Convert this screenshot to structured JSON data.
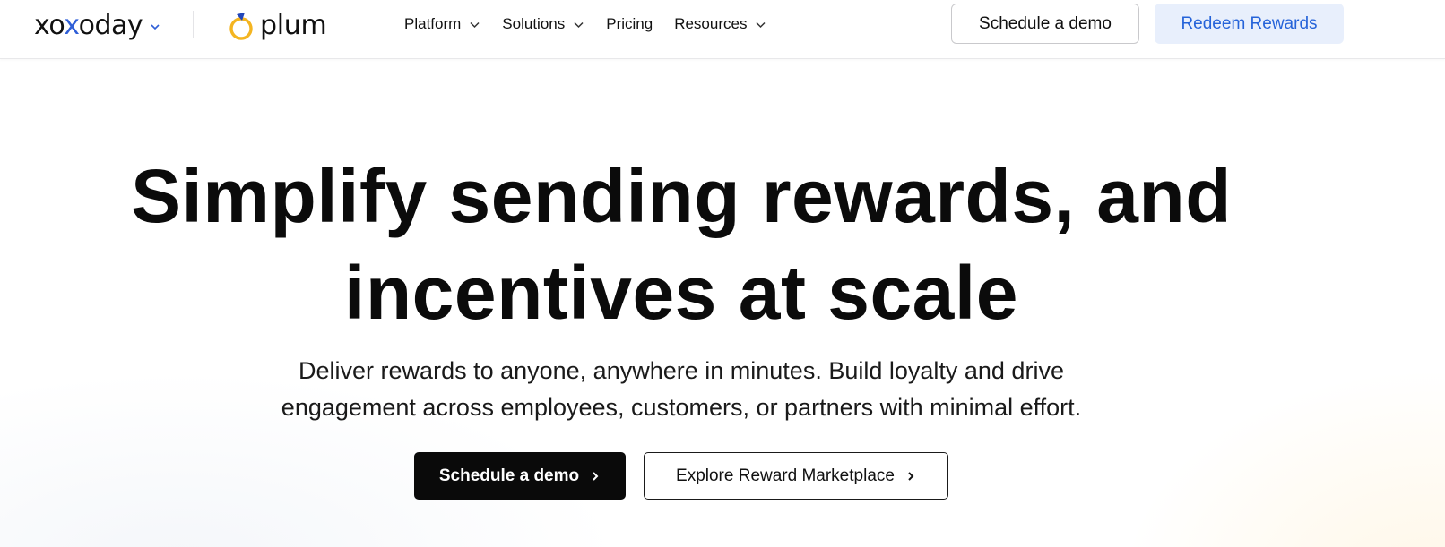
{
  "header": {
    "brand_primary": "xoxoday",
    "brand_secondary": "plum",
    "nav": [
      {
        "label": "Platform",
        "has_dropdown": true
      },
      {
        "label": "Solutions",
        "has_dropdown": true
      },
      {
        "label": "Pricing",
        "has_dropdown": false
      },
      {
        "label": "Resources",
        "has_dropdown": true
      }
    ],
    "schedule_demo_label": "Schedule a demo",
    "redeem_rewards_label": "Redeem Rewards"
  },
  "hero": {
    "title_line1": "Simplify sending rewards, and",
    "title_line2": "incentives at scale",
    "subtitle_line1": "Deliver rewards to anyone, anywhere in minutes. Build loyalty and drive",
    "subtitle_line2": "engagement across employees, customers, or partners with minimal effort.",
    "cta_primary_label": "Schedule a demo",
    "cta_secondary_label": "Explore Reward Marketplace"
  },
  "icons": {
    "chevron_down": "chevron-down-icon",
    "chevron_right": "chevron-right-icon",
    "plum_logo": "plum-logo-icon"
  },
  "colors": {
    "brand_blue": "#2f5fd7",
    "redeem_bg": "#e8effc",
    "redeem_text": "#2563d9",
    "plum_yellow": "#f4b521",
    "cta_primary_bg": "#0a0a0a"
  }
}
